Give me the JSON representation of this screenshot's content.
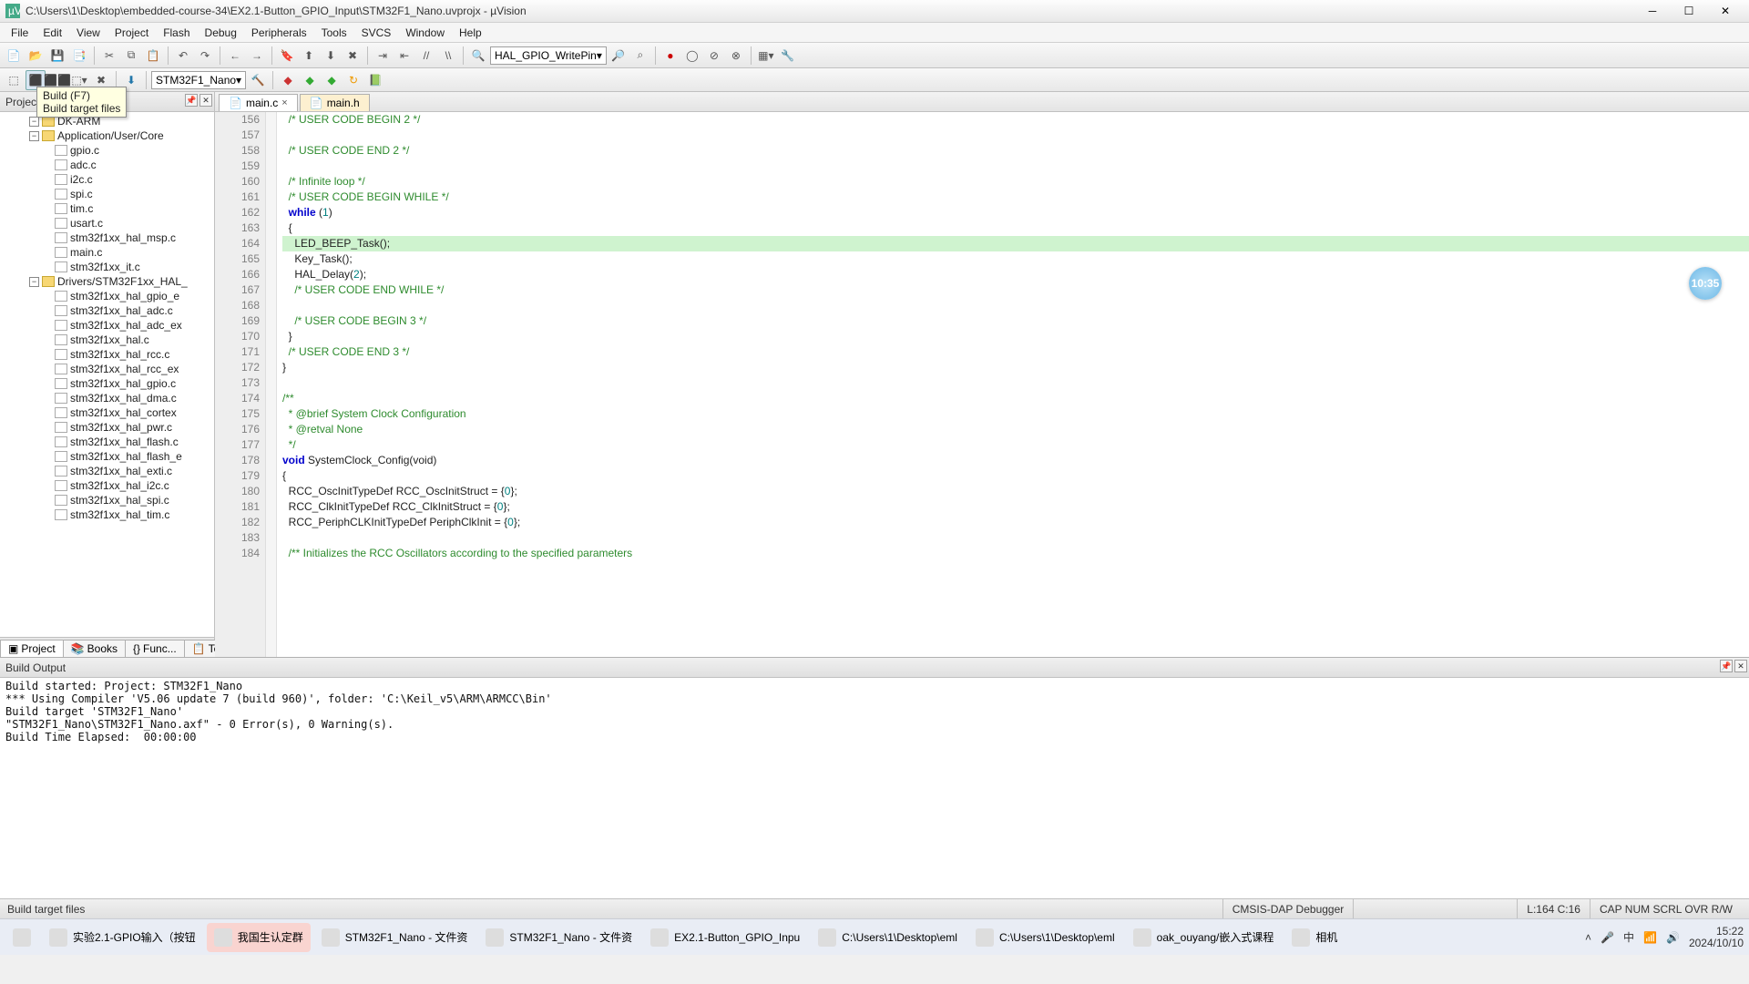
{
  "window": {
    "title": "C:\\Users\\1\\Desktop\\embedded-course-34\\EX2.1-Button_GPIO_Input\\STM32F1_Nano.uvprojx - µVision"
  },
  "menu": [
    "File",
    "Edit",
    "View",
    "Project",
    "Flash",
    "Debug",
    "Peripherals",
    "Tools",
    "SVCS",
    "Window",
    "Help"
  ],
  "toolbar1_combo": "HAL_GPIO_WritePin",
  "toolbar2_target": "STM32F1_Nano",
  "tooltip": {
    "heading": "Build (F7)",
    "desc": "Build target files"
  },
  "project_panel": {
    "title": "Project"
  },
  "project_tree": {
    "root_group": "DK-ARM",
    "groups": [
      {
        "label": "Application/User/Core",
        "expanded": true,
        "files": [
          "gpio.c",
          "adc.c",
          "i2c.c",
          "spi.c",
          "tim.c",
          "usart.c",
          "stm32f1xx_hal_msp.c",
          "main.c",
          "stm32f1xx_it.c"
        ]
      },
      {
        "label": "Drivers/STM32F1xx_HAL_",
        "expanded": true,
        "files": [
          "stm32f1xx_hal_gpio_e",
          "stm32f1xx_hal_adc.c",
          "stm32f1xx_hal_adc_ex",
          "stm32f1xx_hal.c",
          "stm32f1xx_hal_rcc.c",
          "stm32f1xx_hal_rcc_ex",
          "stm32f1xx_hal_gpio.c",
          "stm32f1xx_hal_dma.c",
          "stm32f1xx_hal_cortex",
          "stm32f1xx_hal_pwr.c",
          "stm32f1xx_hal_flash.c",
          "stm32f1xx_hal_flash_e",
          "stm32f1xx_hal_exti.c",
          "stm32f1xx_hal_i2c.c",
          "stm32f1xx_hal_spi.c",
          "stm32f1xx_hal_tim.c"
        ]
      }
    ]
  },
  "project_subtabs": [
    "Project",
    "Books",
    "Func...",
    "Temp..."
  ],
  "editor_tabs": [
    {
      "label": "main.c",
      "active": true
    },
    {
      "label": "main.h",
      "active": false
    }
  ],
  "code": {
    "first_line": 156,
    "lines": [
      {
        "n": 156,
        "text": "  /* USER CODE BEGIN 2 */",
        "cls": "cmt"
      },
      {
        "n": 157,
        "text": "",
        "cls": ""
      },
      {
        "n": 158,
        "text": "  /* USER CODE END 2 */",
        "cls": "cmt"
      },
      {
        "n": 159,
        "text": "",
        "cls": ""
      },
      {
        "n": 160,
        "text": "  /* Infinite loop */",
        "cls": "cmt"
      },
      {
        "n": 161,
        "text": "  /* USER CODE BEGIN WHILE */",
        "cls": "cmt"
      },
      {
        "n": 162,
        "text": "  while (1)",
        "cls": "code",
        "kw": "while",
        "num": "1"
      },
      {
        "n": 163,
        "text": "  {",
        "cls": ""
      },
      {
        "n": 164,
        "text": "    LED_BEEP_Task();",
        "cls": "hl"
      },
      {
        "n": 165,
        "text": "    Key_Task();",
        "cls": ""
      },
      {
        "n": 166,
        "text": "    HAL_Delay(2);",
        "cls": "code",
        "num": "2"
      },
      {
        "n": 167,
        "text": "    /* USER CODE END WHILE */",
        "cls": "cmt"
      },
      {
        "n": 168,
        "text": "",
        "cls": ""
      },
      {
        "n": 169,
        "text": "    /* USER CODE BEGIN 3 */",
        "cls": "cmt"
      },
      {
        "n": 170,
        "text": "  }",
        "cls": ""
      },
      {
        "n": 171,
        "text": "  /* USER CODE END 3 */",
        "cls": "cmt"
      },
      {
        "n": 172,
        "text": "}",
        "cls": ""
      },
      {
        "n": 173,
        "text": "",
        "cls": ""
      },
      {
        "n": 174,
        "text": "/**",
        "cls": "cmt"
      },
      {
        "n": 175,
        "text": "  * @brief System Clock Configuration",
        "cls": "cmt"
      },
      {
        "n": 176,
        "text": "  * @retval None",
        "cls": "cmt"
      },
      {
        "n": 177,
        "text": "  */",
        "cls": "cmt"
      },
      {
        "n": 178,
        "text": "void SystemClock_Config(void)",
        "cls": "code",
        "kw": "void"
      },
      {
        "n": 179,
        "text": "{",
        "cls": ""
      },
      {
        "n": 180,
        "text": "  RCC_OscInitTypeDef RCC_OscInitStruct = {0};",
        "cls": "code",
        "num": "0"
      },
      {
        "n": 181,
        "text": "  RCC_ClkInitTypeDef RCC_ClkInitStruct = {0};",
        "cls": "code",
        "num": "0"
      },
      {
        "n": 182,
        "text": "  RCC_PeriphCLKInitTypeDef PeriphClkInit = {0};",
        "cls": "code",
        "num": "0"
      },
      {
        "n": 183,
        "text": "",
        "cls": ""
      },
      {
        "n": 184,
        "text": "  /** Initializes the RCC Oscillators according to the specified parameters",
        "cls": "cmt"
      }
    ]
  },
  "build_output": {
    "title": "Build Output",
    "lines": [
      "Build started: Project: STM32F1_Nano",
      "*** Using Compiler 'V5.06 update 7 (build 960)', folder: 'C:\\Keil_v5\\ARM\\ARMCC\\Bin'",
      "Build target 'STM32F1_Nano'",
      "\"STM32F1_Nano\\STM32F1_Nano.axf\" - 0 Error(s), 0 Warning(s).",
      "Build Time Elapsed:  00:00:00"
    ]
  },
  "statusbar": {
    "left": "Build target files",
    "debugger": "CMSIS-DAP Debugger",
    "cursor": "L:164 C:16",
    "flags": [
      "CAP",
      "NUM",
      "SCRL",
      "OVR",
      "R/W"
    ]
  },
  "badge": "10:35",
  "taskbar": {
    "items": [
      {
        "label": "",
        "icon": "windows"
      },
      {
        "label": "实验2.1-GPIO输入（按钮",
        "icon": "wps"
      },
      {
        "label": "我国生认定群",
        "icon": "chat",
        "active": true
      },
      {
        "label": "STM32F1_Nano - 文件资",
        "icon": "folder"
      },
      {
        "label": "STM32F1_Nano - 文件资",
        "icon": "folder"
      },
      {
        "label": "EX2.1-Button_GPIO_Inpu",
        "icon": "folder"
      },
      {
        "label": "C:\\Users\\1\\Desktop\\eml",
        "icon": "keil"
      },
      {
        "label": "C:\\Users\\1\\Desktop\\eml",
        "icon": "keil"
      },
      {
        "label": "oak_ouyang/嵌入式课程",
        "icon": "firefox"
      },
      {
        "label": "相机",
        "icon": "camera"
      }
    ],
    "time": "15:22",
    "date": "2024/10/10"
  }
}
